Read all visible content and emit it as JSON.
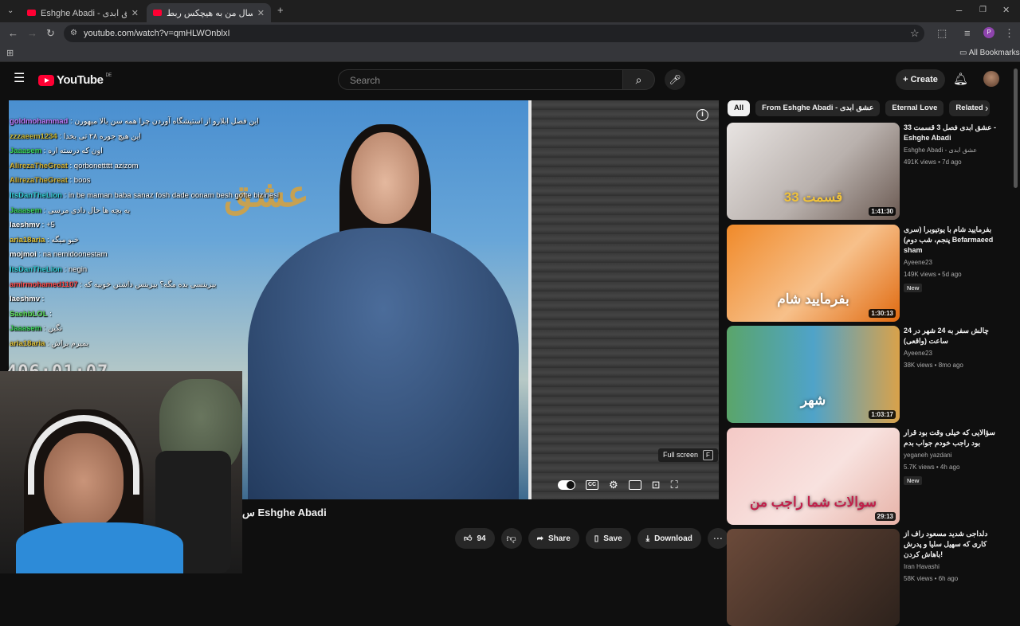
{
  "browser": {
    "tabs": [
      {
        "title": "Eshghe Abadi - عشق ابدی - You"
      },
      {
        "title": "سن و سال من به هیچکس ربط"
      }
    ],
    "url": "youtube.com/watch?v=qmHLWOnblxI",
    "bookmarks_label": "All Bookmarks",
    "profile_initial": "P"
  },
  "youtube": {
    "logo_text": "YouTube",
    "region": "DE",
    "search_placeholder": "Search",
    "create_label": "+ Create"
  },
  "player": {
    "stream_clock": "406:01:07",
    "chat": [
      {
        "user": "goldmohammad",
        "color": "#c27cff",
        "msg": ": این فصل ابلارو از استیشگاه آوردن چرا همه سن بالا میهورن"
      },
      {
        "user": "zzzaeem1234",
        "color": "#c9b93a",
        "msg": ": این هیچ جوره ۲۸ تی بخدا"
      },
      {
        "user": "Jaaasem",
        "color": "#3cd65a",
        "msg": ": اون که درسته اره"
      },
      {
        "user": "AlirezaTheGreat",
        "color": "#d2b43a",
        "msg": ": qorbonettttt azizom"
      },
      {
        "user": "AlirezaTheGreat",
        "color": "#d2b43a",
        "msg": ": boos"
      },
      {
        "user": "ItsDanTheLion",
        "color": "#35d0d8",
        "msg": ": in be maman baba sanaz fosh dade oonam besh gofte bizinesi"
      },
      {
        "user": "Jaaasem",
        "color": "#3cd65a",
        "msg": ": به بچه ها حال دادی مرسی"
      },
      {
        "user": "laeshmv",
        "color": "#ffffff",
        "msg": ": +5"
      },
      {
        "user": "aria18aria",
        "color": "#e0c23a",
        "msg": ": خیو میگه"
      },
      {
        "user": "mojmoi",
        "color": "#ffffff",
        "msg": ": na nemidoonestam"
      },
      {
        "user": "ItsDanTheLion",
        "color": "#35d0d8",
        "msg": ": negin"
      },
      {
        "user": "amirmohamed1107",
        "color": "#ff4d4d",
        "msg": ": بیزینسی بده مگه؟ بیزینس داشتن خوبیه که"
      },
      {
        "user": "laeshmv",
        "color": "#ffffff",
        "msg": ":"
      },
      {
        "user": "SaehbLOL",
        "color": "#5ee05a",
        "msg": ":"
      },
      {
        "user": "Jaaasem",
        "color": "#3cd65a",
        "msg": ": نگین"
      },
      {
        "user": "aria18aria",
        "color": "#e0c23a",
        "msg": ": بمیرم براش"
      }
    ],
    "tooltip_label": "Full screen",
    "tooltip_key": "F"
  },
  "video": {
    "title": "س Eshghe Abadi",
    "like_count": "94",
    "share_label": "Share",
    "save_label": "Save",
    "download_label": "Download"
  },
  "chips": [
    "All",
    "From Eshghe Abadi - عشق ابدی",
    "Eternal Love",
    "Related"
  ],
  "recommendations": [
    {
      "title": "عشق ابدی فصل 3 قسمت 33 - Eshghe Abadi",
      "channel": "Eshghe Abadi - عشق ابدی",
      "stats": "491K views • 7d ago",
      "duration": "1:41:30",
      "badge": "",
      "thumb_text": "قسمت 33"
    },
    {
      "title": "بفرمایید شام با یوتیوبرا (سری پنجم، شب دوم) Befarmaeed sham",
      "channel": "Ayeene23",
      "stats": "149K views • 5d ago",
      "duration": "1:30:13",
      "badge": "New",
      "thumb_text": "بفرمایید شام"
    },
    {
      "title": "چالش سفر به 24 شهر در 24 ساعت (واقعی)",
      "channel": "Ayeene23",
      "stats": "38K views • 8mo ago",
      "duration": "1:03:17",
      "badge": "",
      "thumb_text": "شهر"
    },
    {
      "title": "سؤالایی که خیلی وقت بود قرار بود راجب خودم جواب بدم",
      "channel": "yeganeh yazdani",
      "stats": "5.7K views • 4h ago",
      "duration": "29:13",
      "badge": "New",
      "thumb_text": "سوالات شما راجب من"
    },
    {
      "title": "دلداجی شدید مسعود راف از کاری که سهیل سلیا و پدرش باهاش کردن!",
      "channel": "Iran Havashi",
      "stats": "58K views • 6h ago",
      "duration": "",
      "badge": "",
      "thumb_text": ""
    }
  ]
}
